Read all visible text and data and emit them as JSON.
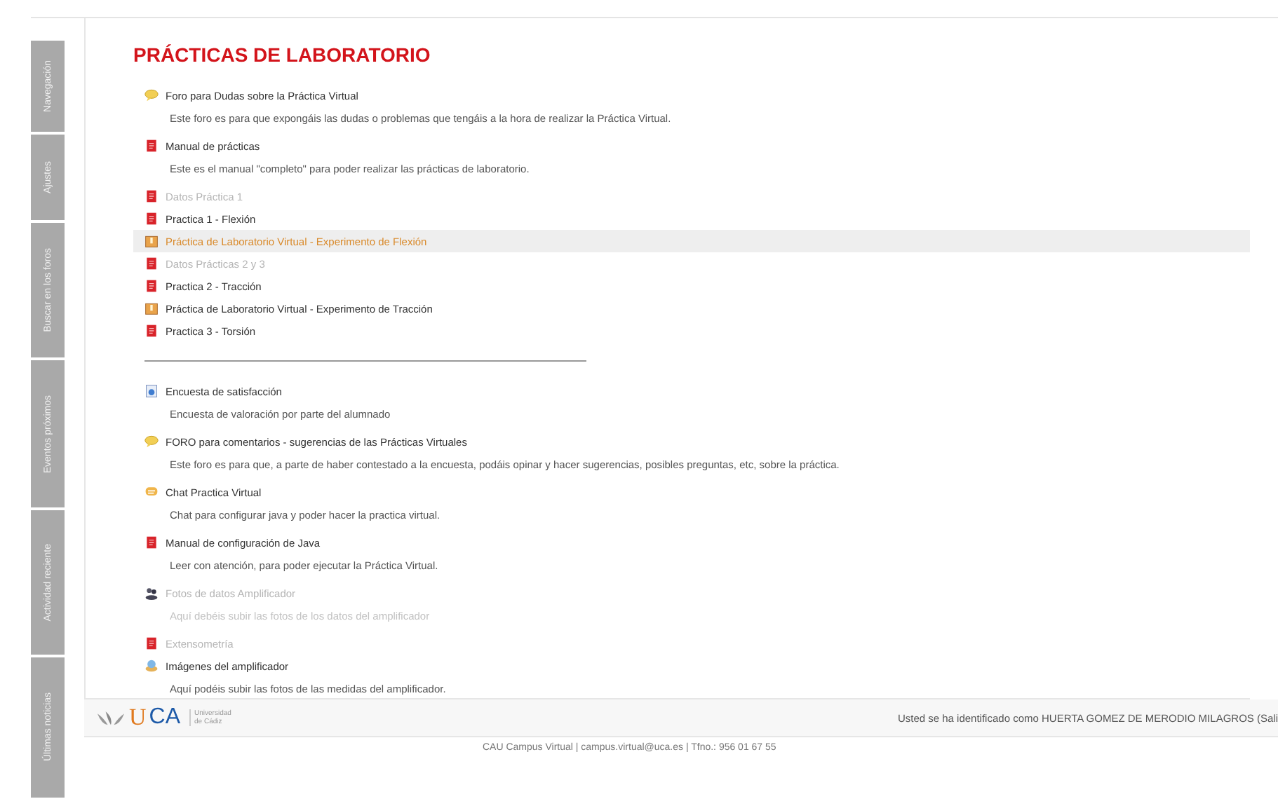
{
  "side_tabs": [
    {
      "label": "Navegación"
    },
    {
      "label": "Ajustes"
    },
    {
      "label": "Buscar en los foros"
    },
    {
      "label": "Eventos próximos"
    },
    {
      "label": "Actividad reciente"
    },
    {
      "label": "Últimas noticias"
    }
  ],
  "title": "PRÁCTICAS DE LABORATORIO",
  "sections": [
    {
      "items": [
        {
          "kind": "forum",
          "label": "Foro para Dudas sobre la Práctica Virtual",
          "hidden": false,
          "highlighted": false,
          "description": "Este foro es para que expongáis las dudas o problemas que tengáis a la hora de realizar la Práctica Virtual."
        },
        {
          "kind": "pdf",
          "label": "Manual de prácticas",
          "hidden": false,
          "highlighted": false,
          "description": "Este es el manual \"completo\" para poder realizar las prácticas de laboratorio."
        },
        {
          "kind": "pdf",
          "label": "Datos Práctica 1",
          "hidden": true,
          "highlighted": false
        },
        {
          "kind": "pdf",
          "label": "Practica 1 - Flexión",
          "hidden": false,
          "highlighted": false
        },
        {
          "kind": "package",
          "label": "Práctica de Laboratorio Virtual - Experimento de Flexión",
          "hidden": false,
          "highlighted": true
        },
        {
          "kind": "pdf",
          "label": "Datos Prácticas 2 y 3",
          "hidden": true,
          "highlighted": false
        },
        {
          "kind": "pdf",
          "label": "Practica 2 - Tracción",
          "hidden": false,
          "highlighted": false
        },
        {
          "kind": "package",
          "label": "Práctica de Laboratorio Virtual - Experimento de Tracción",
          "hidden": false,
          "highlighted": false
        },
        {
          "kind": "pdf",
          "label": "Practica 3 - Torsión",
          "hidden": false,
          "highlighted": false
        }
      ]
    },
    {
      "items": [
        {
          "kind": "survey",
          "label": "Encuesta de satisfacción",
          "hidden": false,
          "highlighted": false,
          "description": "Encuesta de valoración por parte del alumnado"
        },
        {
          "kind": "forum",
          "label": "FORO para comentarios - sugerencias de las Prácticas Virtuales",
          "hidden": false,
          "highlighted": false,
          "description": "Este foro es para que, a parte de haber contestado a la encuesta, podáis opinar y hacer sugerencias, posibles preguntas, etc, sobre la práctica."
        },
        {
          "kind": "chat",
          "label": "Chat Practica Virtual",
          "hidden": false,
          "highlighted": false,
          "description": "Chat para configurar java y poder hacer la practica virtual."
        },
        {
          "kind": "pdf",
          "label": "Manual de configuración de Java",
          "hidden": false,
          "highlighted": false,
          "description": "Leer con atención, para poder ejecutar la Práctica Virtual."
        },
        {
          "kind": "workshop",
          "label": "Fotos de datos Amplificador",
          "hidden": true,
          "highlighted": false,
          "description": "Aquí debéis subir las fotos de los datos del amplificador"
        },
        {
          "kind": "pdf",
          "label": "Extensometría",
          "hidden": true,
          "highlighted": false
        },
        {
          "kind": "upload",
          "label": "Imágenes del amplificador",
          "hidden": false,
          "highlighted": false,
          "description": "Aquí podéis subir las fotos de las medidas del amplificador."
        }
      ]
    }
  ],
  "footer": {
    "logo_main_1": "U",
    "logo_main_2": "CA",
    "logo_sub_1": "Universidad",
    "logo_sub_2": "de Cádiz",
    "login_info": "Usted se ha identificado como HUERTA GOMEZ DE MERODIO MILAGROS (Sali",
    "contact": "CAU Campus Virtual | campus.virtual@uca.es | Tfno.: 956 01 67 55"
  }
}
